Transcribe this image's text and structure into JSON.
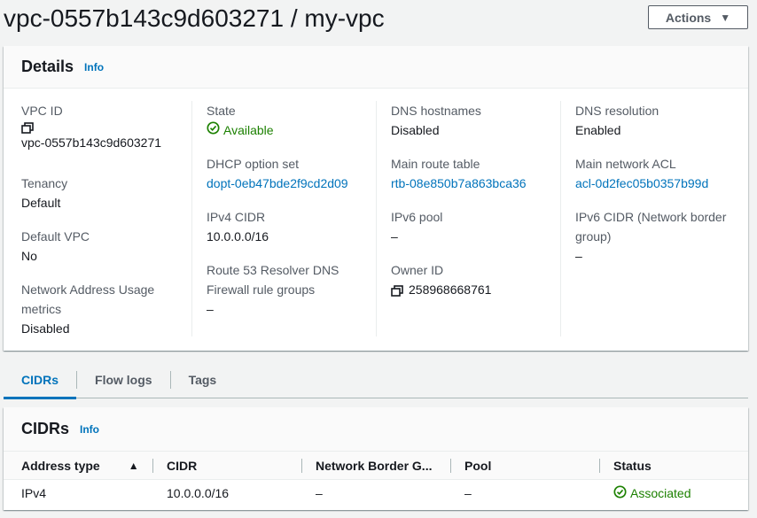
{
  "header": {
    "title": "vpc-0557b143c9d603271 / my-vpc",
    "actions_label": "Actions"
  },
  "details": {
    "title": "Details",
    "info": "Info",
    "fields": {
      "vpc_id": {
        "label": "VPC ID",
        "value": "vpc-0557b143c9d603271"
      },
      "tenancy": {
        "label": "Tenancy",
        "value": "Default"
      },
      "default_vpc": {
        "label": "Default VPC",
        "value": "No"
      },
      "nau_metrics": {
        "label_line1": "Network Address Usage",
        "label_line2": "metrics",
        "value": "Disabled"
      },
      "state": {
        "label": "State",
        "value": "Available"
      },
      "dhcp": {
        "label": "DHCP option set",
        "value": "dopt-0eb47bde2f9cd2d09"
      },
      "ipv4_cidr": {
        "label": "IPv4 CIDR",
        "value": "10.0.0.0/16"
      },
      "route53": {
        "label_line1": "Route 53 Resolver DNS",
        "label_line2": "Firewall rule groups",
        "value": "–"
      },
      "dns_hostnames": {
        "label": "DNS hostnames",
        "value": "Disabled"
      },
      "main_route_table": {
        "label": "Main route table",
        "value": "rtb-08e850b7a863bca36"
      },
      "ipv6_pool": {
        "label": "IPv6 pool",
        "value": "–"
      },
      "owner_id": {
        "label": "Owner ID",
        "value": "258968668761"
      },
      "dns_resolution": {
        "label": "DNS resolution",
        "value": "Enabled"
      },
      "main_acl": {
        "label": "Main network ACL",
        "value": "acl-0d2fec05b0357b99d"
      },
      "ipv6_cidr": {
        "label_line1": "IPv6 CIDR (Network border",
        "label_line2": "group)",
        "value": "–"
      }
    }
  },
  "tabs": [
    {
      "label": "CIDRs",
      "active": true
    },
    {
      "label": "Flow logs",
      "active": false
    },
    {
      "label": "Tags",
      "active": false
    }
  ],
  "cidrs": {
    "title": "CIDRs",
    "info": "Info",
    "columns": [
      "Address type",
      "CIDR",
      "Network Border G...",
      "Pool",
      "Status"
    ],
    "rows": [
      {
        "address_type": "IPv4",
        "cidr": "10.0.0.0/16",
        "nbg": "–",
        "pool": "–",
        "status": "Associated"
      }
    ]
  },
  "colors": {
    "link": "#0073bb",
    "success": "#1d8102",
    "text": "#16191f",
    "label": "#545b64",
    "background": "#f2f3f3"
  },
  "icons": [
    "copy-icon",
    "status-available-icon",
    "sort-ascending-icon",
    "caret-down-icon"
  ]
}
